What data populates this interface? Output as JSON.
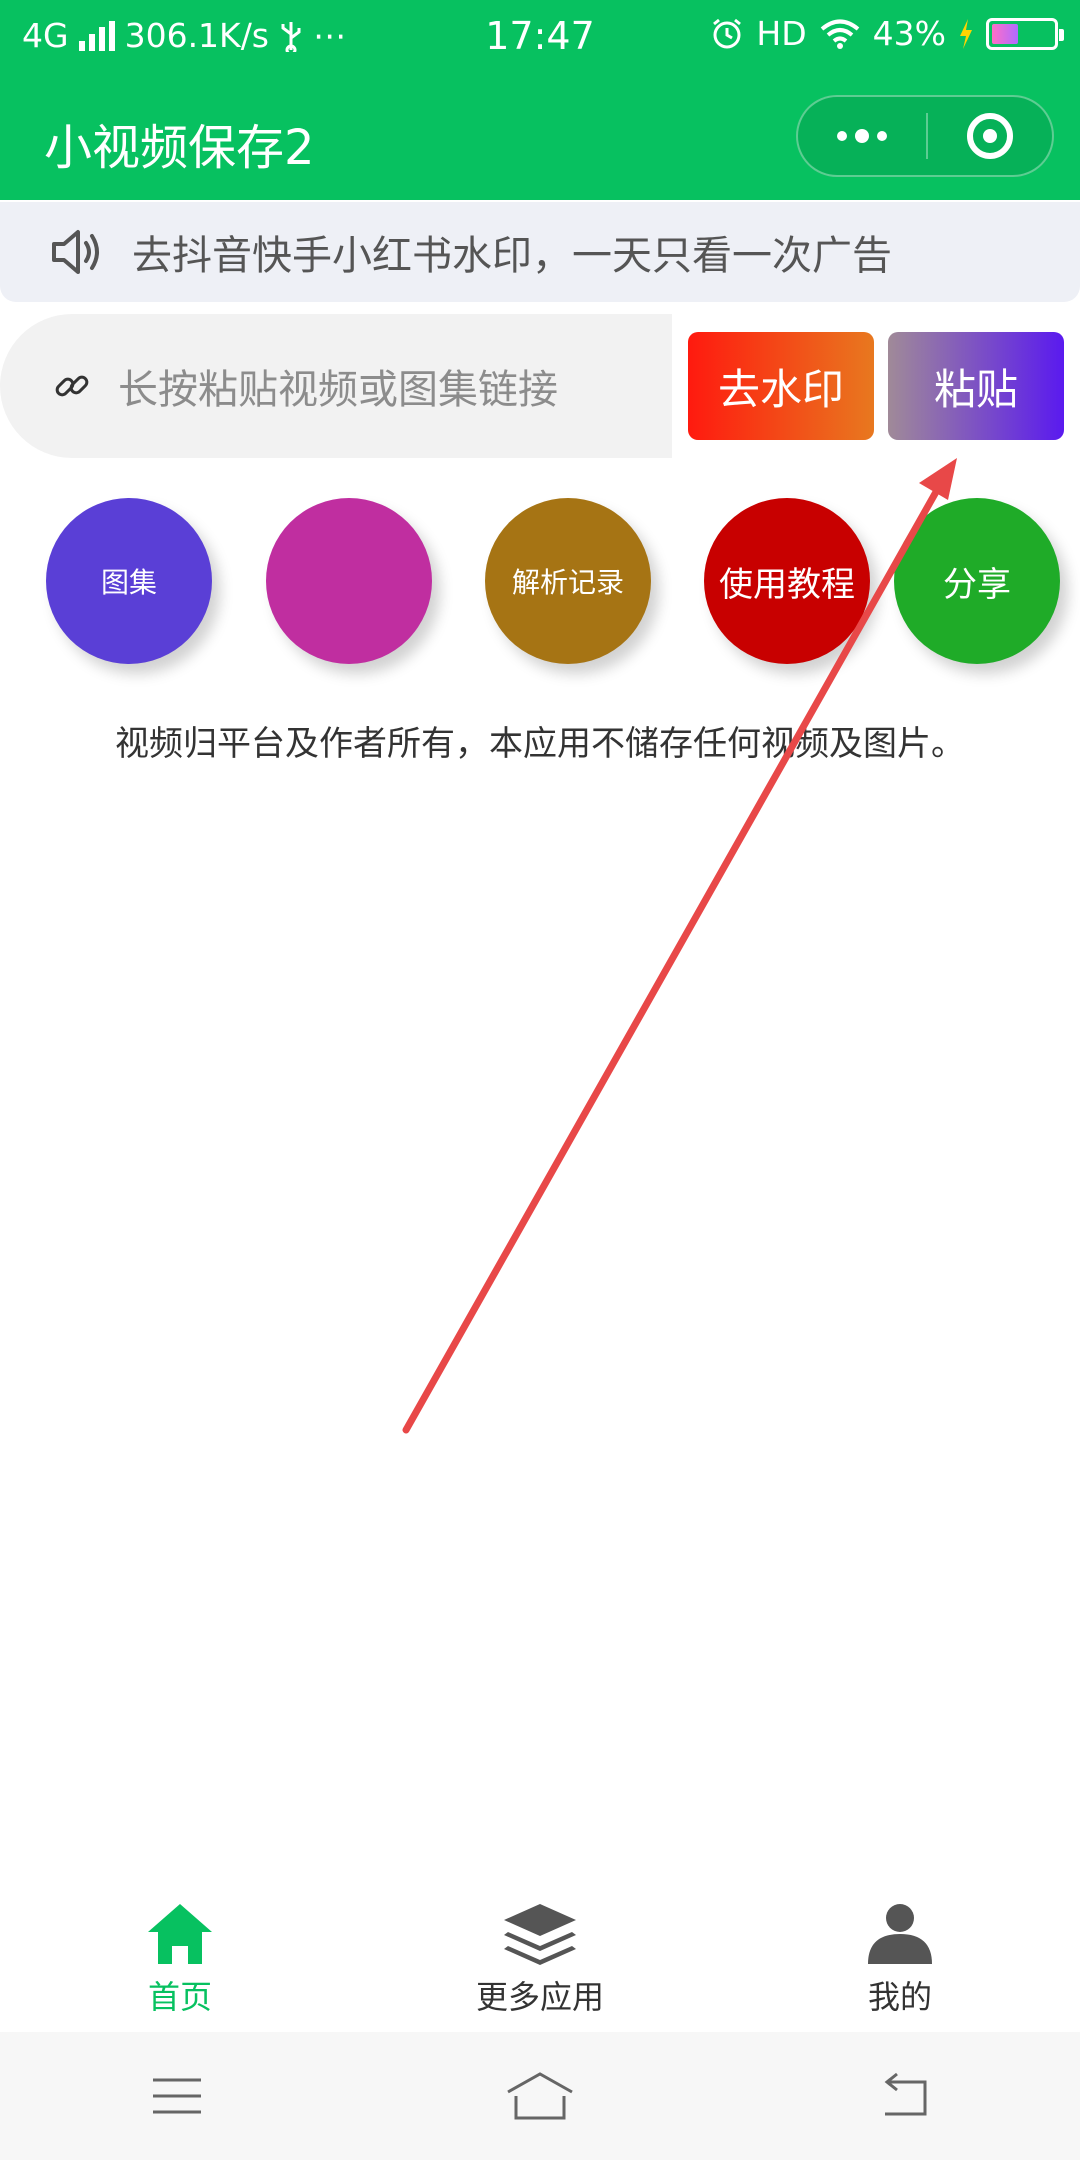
{
  "status_bar": {
    "network": "4G",
    "speed": "306.1K/s",
    "extra": "⋯",
    "time": "17:47",
    "hd": "HD",
    "battery": "43%"
  },
  "nav": {
    "title": "小视频保存2"
  },
  "notice": {
    "text": "去抖音快手小红书水印，一天只看一次广告"
  },
  "input": {
    "placeholder": "长按粘贴视频或图集链接"
  },
  "buttons": {
    "remove_watermark": "去水印",
    "paste": "粘贴"
  },
  "shortcuts": [
    {
      "label": "图集",
      "color": "#5a3fd6"
    },
    {
      "label": "",
      "color": "#c02ea0"
    },
    {
      "label": "解析记录",
      "color": "#a67414"
    },
    {
      "label": "使用教程",
      "color": "#c80000"
    },
    {
      "label": "分享",
      "color": "#1fab28"
    }
  ],
  "disclaimer": "视频归平台及作者所有，本应用不储存任何视频及图片。",
  "tabbar": {
    "items": [
      {
        "label": "首页",
        "icon": "home-icon",
        "active": true
      },
      {
        "label": "更多应用",
        "icon": "layers-icon",
        "active": false
      },
      {
        "label": "我的",
        "icon": "user-icon",
        "active": false
      }
    ]
  },
  "colors": {
    "brand": "#07c160",
    "arrow": "#e84848"
  }
}
